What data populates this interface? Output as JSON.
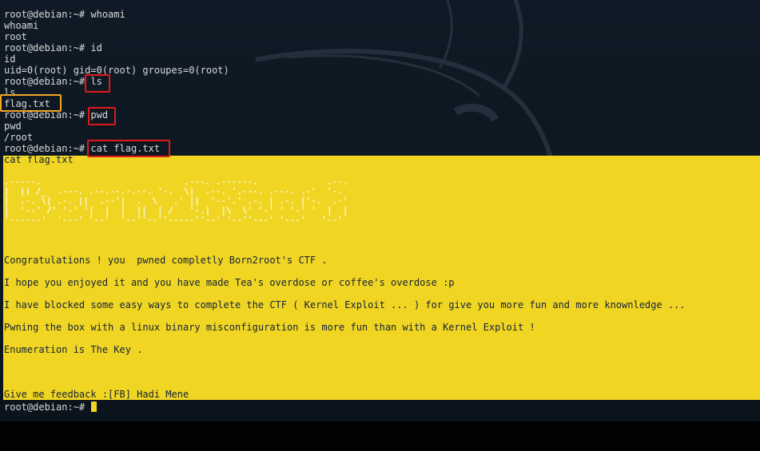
{
  "terminal": {
    "lines": [
      "root@debian:~# whoami",
      "whoami",
      "root",
      "root@debian:~# id",
      "id",
      "uid=0(root) gid=0(root) groupes=0(root)",
      "root@debian:~# ls",
      "ls",
      "flag.txt",
      "root@debian:~# pwd",
      "pwd",
      "/root",
      "root@debian:~# cat flag.txt",
      "cat flag.txt"
    ],
    "ascii_art": [
      ".-----.                           .---. .------.             .--.",
      "|  |) /_  .---. .--.--.-.--. '-.  \\|  .--. '.---. .---. .-'  '-.",
      "|  .-. \\| .-. ||  .--'|  .  \\   .' ||  '--'.' .-. | .-. |'-.  .-'",
      "|  '--' /' '-' '|  |  |  ||  | /   '-.|  |\\  \\' '-' ' '-' '  |  |",
      "'------'  '---' '--'  '--''--''-----''--' '--''---' '---'   '--'"
    ],
    "messages": [
      "Congratulations ! you  pwned completly Born2root's CTF .",
      "I hope you enjoyed it and you have made Tea's overdose or coffee's overdose :p",
      "I have blocked some easy ways to complete the CTF ( Kernel Exploit ... ) for give you more fun and more knownledge ...",
      "Pwning the box with a linux binary misconfiguration is more fun than with a Kernel Exploit !",
      "Enumeration is The Key .",
      "Give me feedback :[FB] Hadi Mene"
    ],
    "prompt": "root@debian:~# "
  },
  "colors": {
    "highlight": "#f0d623",
    "annotation_red": "#e2191c",
    "annotation_orange": "#f5a623"
  }
}
